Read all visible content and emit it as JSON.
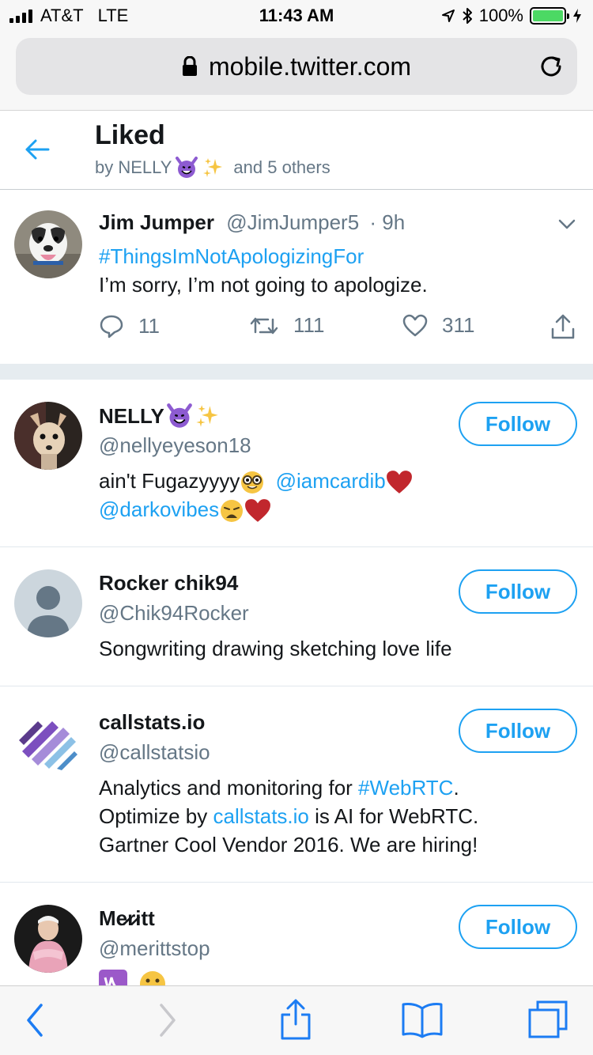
{
  "status_bar": {
    "carrier": "AT&T",
    "network": "LTE",
    "time": "11:43 AM",
    "battery": "100%",
    "battery_level": 1.0
  },
  "browser": {
    "url": "mobile.twitter.com",
    "icons": [
      "lock-icon",
      "reload-icon",
      "back-icon",
      "forward-icon",
      "share-icon",
      "bookmarks-icon",
      "tabs-icon"
    ]
  },
  "header": {
    "title": "Liked",
    "subtitle_prefix": "by NELLY",
    "subtitle_suffix": "and 5 others"
  },
  "tweet": {
    "name": "Jim Jumper",
    "handle": "@JimJumper5",
    "time": "· 9h",
    "hashtag": "#ThingsImNotApologizingFor",
    "text": "I’m sorry, I’m not going to apologize.",
    "replies": "11",
    "retweets": "111",
    "likes": "311"
  },
  "users": [
    {
      "name": "NELLY",
      "handle": "@nellyeyeson18",
      "bio_1": "ain't Fugazyyyy",
      "bio_link_1": "@iamcardib",
      "bio_link_2": "@darkovibes",
      "follow_label": "Follow"
    },
    {
      "name": "Rocker chik94",
      "handle": "@Chik94Rocker",
      "bio": "Songwriting drawing sketching love life",
      "follow_label": "Follow"
    },
    {
      "name": "callstats.io",
      "handle": "@callstatsio",
      "bio_1": "Analytics and monitoring for ",
      "bio_link_1": "#WebRTC",
      "bio_2": ".",
      "bio_3": "Optimize by ",
      "bio_link_2": "callstats.io",
      "bio_4": " is AI for WebRTC.",
      "bio_5": "Gartner Cool Vendor 2016. We are hiring!",
      "follow_label": "Follow"
    },
    {
      "name": "Me̷r̷itt",
      "handle": "@merittstop",
      "follow_label": "Follow"
    }
  ],
  "colors": {
    "twitter_blue": "#1da1f2",
    "secondary_text": "#657786",
    "ios_blue": "#1c7cf3"
  }
}
